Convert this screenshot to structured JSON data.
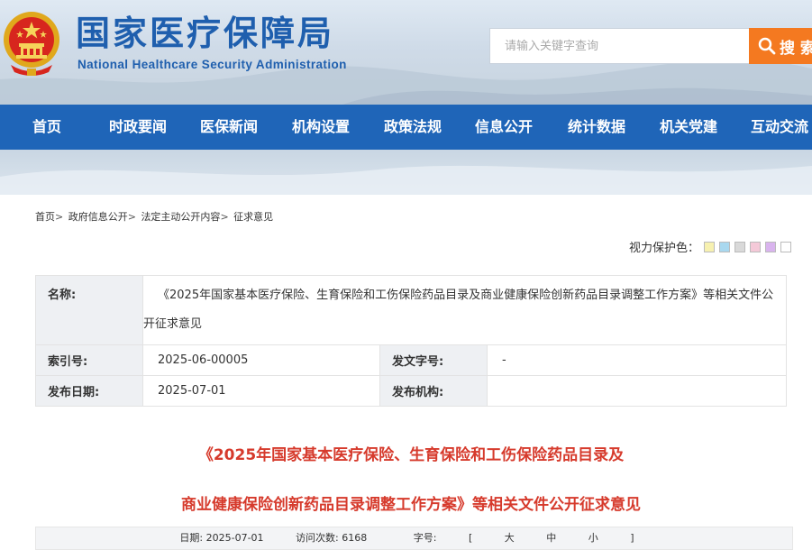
{
  "header": {
    "title": "国家医疗保障局",
    "subtitle": "National Healthcare Security Administration",
    "search_placeholder": "请输入关键字查询",
    "search_button": "搜 索",
    "colors": {
      "brand_blue": "#1f5fae",
      "nav_blue": "#1f65b8",
      "search_orange": "#f47920",
      "title_red": "#d63a2c"
    }
  },
  "nav": {
    "items": [
      "首页",
      "时政要闻",
      "医保新闻",
      "机构设置",
      "政策法规",
      "信息公开",
      "统计数据",
      "机关党建",
      "互动交流"
    ]
  },
  "breadcrumb": {
    "items": [
      "首页",
      "政府信息公开",
      "法定主动公开内容",
      "征求意见"
    ]
  },
  "eye_protect": {
    "label": "视力保护色：",
    "swatches": [
      "#f7f1b0",
      "#a9d8ef",
      "#d9d9d9",
      "#f4c9d8",
      "#d9b4ee",
      "#ffffff"
    ]
  },
  "meta": {
    "name_label": "名称:",
    "name_value": "《2025年国家基本医疗保险、生育保险和工伤保险药品目录及商业健康保险创新药品目录调整工作方案》等相关文件公开征求意见",
    "index_label": "索引号:",
    "index_value": "2025-06-00005",
    "docno_label": "发文字号:",
    "docno_value": "-",
    "date_label": "发布日期:",
    "date_value": "2025-07-01",
    "org_label": "发布机构:",
    "org_value": ""
  },
  "article": {
    "title_line1": "《2025年国家基本医疗保险、生育保险和工伤保险药品目录及",
    "title_line2": "商业健康保险创新药品目录调整工作方案》等相关文件公开征求意见"
  },
  "info_bar": {
    "date_text": "日期:  2025-07-01",
    "visits_text": "访问次数:  6168",
    "font_label": "字号:",
    "font_open": "[",
    "font_large": "大",
    "font_medium": "中",
    "font_small": "小",
    "font_close": "]"
  }
}
